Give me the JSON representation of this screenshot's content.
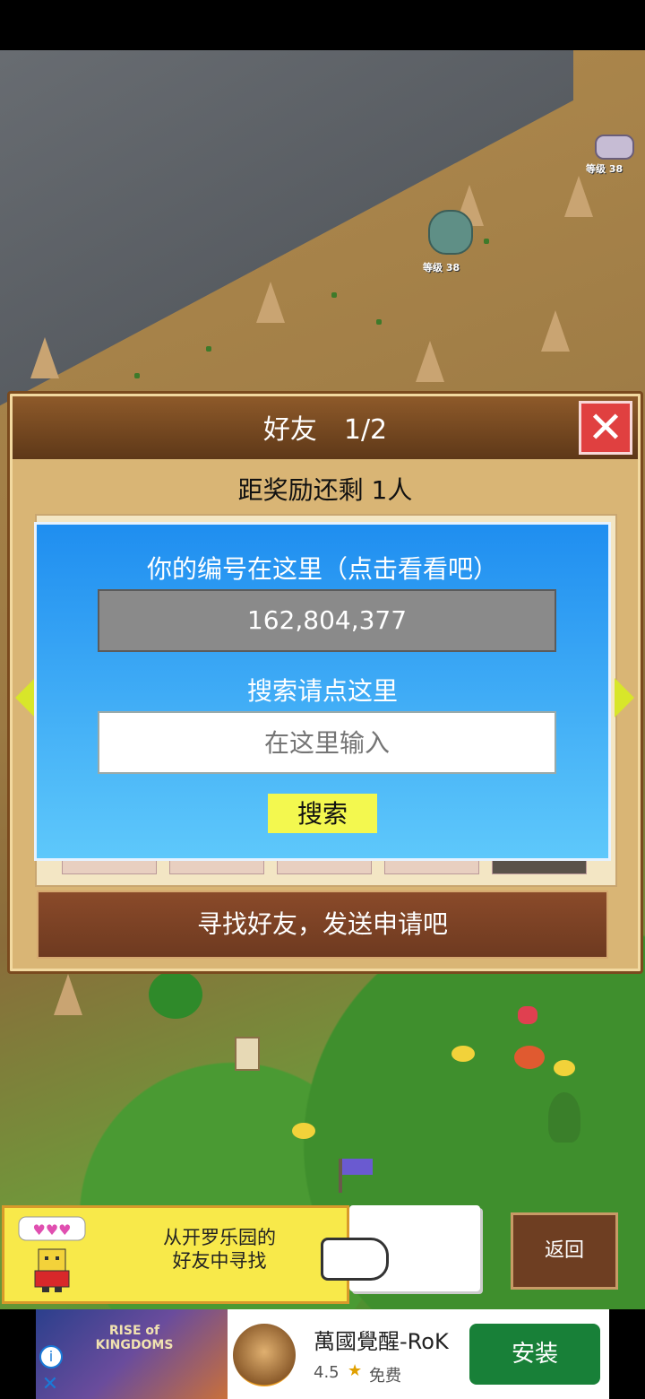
{
  "world": {
    "enemy_level_1": "等级 38",
    "enemy_level_2": "等级 38"
  },
  "friend_panel": {
    "title": "好友　1/2",
    "reward_text": "距奖励还剩 1人",
    "find_button": "寻找好友，发送申请吧",
    "close_icon": "close-icon"
  },
  "search_dialog": {
    "id_label": "你的编号在这里（点击看看吧）",
    "id_value": "162,804,377",
    "search_label": "搜索请点这里",
    "input_placeholder": "在这里输入",
    "search_button": "搜索"
  },
  "helper": {
    "text": "从开罗乐园的\n好友中寻找",
    "back_button": "返回"
  },
  "ad": {
    "image_text": "RISE of KINGDOMS",
    "title": "萬國覺醒-RoK",
    "rating": "4.5",
    "free": "免费",
    "install": "安装",
    "install_color": "#188038"
  }
}
